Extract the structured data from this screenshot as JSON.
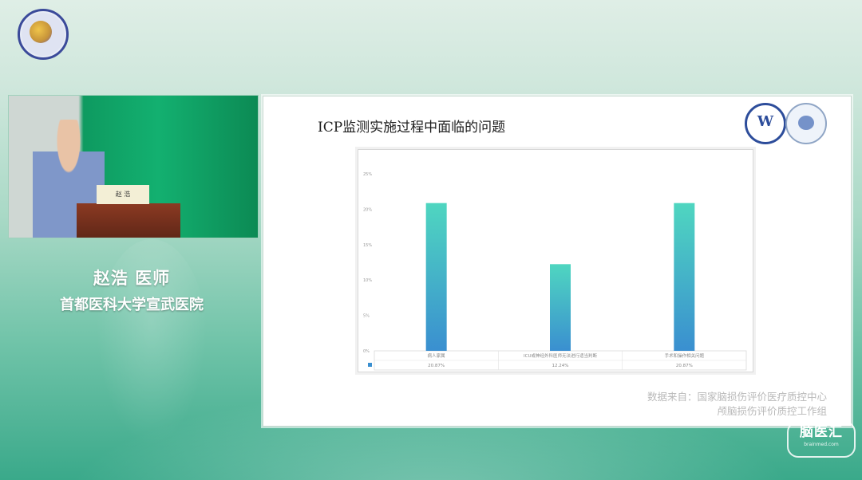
{
  "speaker": {
    "name": "赵浩 医师",
    "organization": "首都医科大学宣武医院",
    "placard": "赵 浩"
  },
  "slide": {
    "title": "ICP监测实施过程中面临的问题",
    "source_line1": "数据来自：国家脑损伤评价医疗质控中心",
    "source_line2": "颅脑损伤评价质控工作组"
  },
  "watermark": {
    "text": "脑医汇",
    "sub": "brainmed.com"
  },
  "colors": {
    "bar_top": "#4fd6c0",
    "bar_bottom": "#3a8fd0",
    "accent_green": "#13b070"
  },
  "chart_data": {
    "type": "bar",
    "categories": [
      "病人家属",
      "ICU或神经外科医师无法进行适当判断",
      "手术和操作相关问题"
    ],
    "series": [
      {
        "values": [
          20.87,
          12.24,
          20.87
        ]
      }
    ],
    "data_labels": [
      "20.87%",
      "12.24%",
      "20.87%"
    ],
    "y_ticks": [
      "0%",
      "5%",
      "10%",
      "15%",
      "20%",
      "25%"
    ],
    "ylim": [
      0,
      25
    ],
    "grid": false,
    "legend_position": "bottom-left table"
  }
}
